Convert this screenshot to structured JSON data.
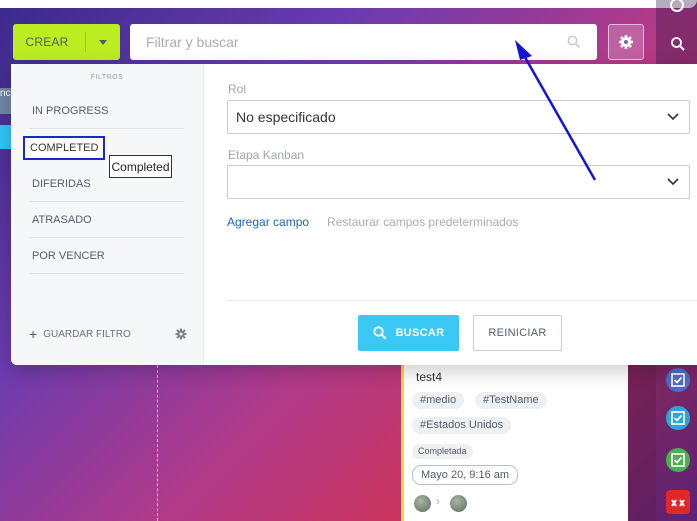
{
  "toolbar": {
    "create_label": "CREAR",
    "search_placeholder": "Filtrar y buscar"
  },
  "left_edge_text": "nc",
  "filters": {
    "title": "FILTROS",
    "items": [
      {
        "label": "IN PROGRESS"
      },
      {
        "label": "COMPLETED"
      },
      {
        "label": "DIFERIDAS"
      },
      {
        "label": "ATRASADO"
      },
      {
        "label": "POR VENCER"
      }
    ],
    "tooltip": "Completed",
    "save_label": "GUARDAR FILTRO"
  },
  "form": {
    "role_label": "Rol",
    "role_value": "No especificado",
    "kanban_label": "Etapa Kanban",
    "kanban_value": "",
    "add_field": "Agregar campo",
    "restore_fields": "Restaurar campos predeterminados",
    "search_button": "BUSCAR",
    "reset_button": "REINICIAR"
  },
  "card": {
    "title": "test4",
    "tags": [
      "#medio",
      "#TestName",
      "#Estados Unidos"
    ],
    "status": "Completada",
    "date": "Mayo 20, 9:16 am"
  },
  "colors": {
    "create_button": "#bbed21",
    "search_button": "#3bc8f5",
    "selection_outline": "#1a28c8",
    "annotation_arrow": "#1414d8"
  }
}
